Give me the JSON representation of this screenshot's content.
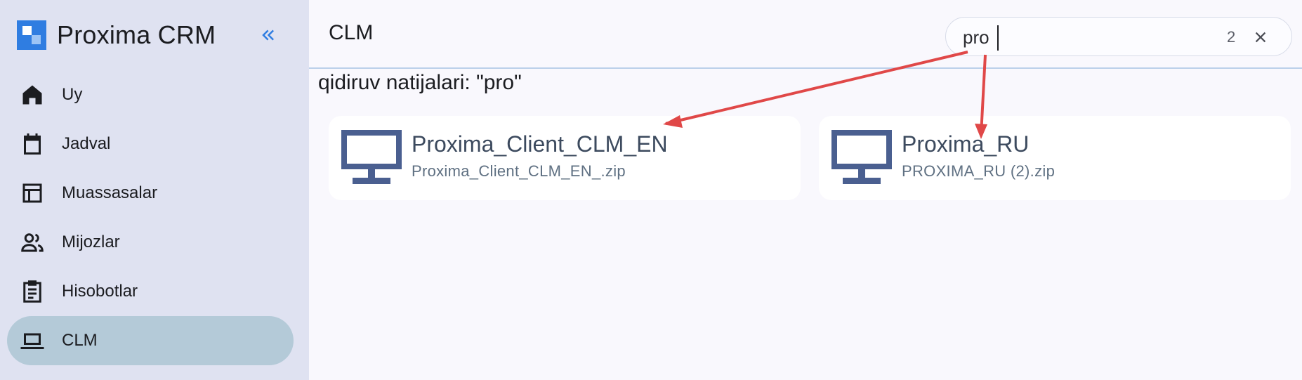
{
  "app": {
    "name": "Proxima CRM"
  },
  "sidebar": {
    "items": [
      {
        "label": "Uy",
        "icon": "home-icon",
        "active": false
      },
      {
        "label": "Jadval",
        "icon": "calendar-icon",
        "active": false
      },
      {
        "label": "Muassasalar",
        "icon": "table-icon",
        "active": false
      },
      {
        "label": "Mijozlar",
        "icon": "people-icon",
        "active": false
      },
      {
        "label": "Hisobotlar",
        "icon": "clipboard-icon",
        "active": false
      },
      {
        "label": "CLM",
        "icon": "laptop-icon",
        "active": true
      }
    ]
  },
  "header": {
    "title": "CLM"
  },
  "search": {
    "value": "pro",
    "count": "2"
  },
  "results": {
    "label": "qidiruv natijalari: \"pro\"",
    "items": [
      {
        "title": "Proxima_Client_CLM_EN",
        "file": "Proxima_Client_CLM_EN_.zip",
        "icon": "monitor-icon"
      },
      {
        "title": "Proxima_RU",
        "file": "PROXIMA_RU (2).zip",
        "icon": "monitor-icon"
      }
    ]
  },
  "colors": {
    "sidebar_bg": "#dfe2f1",
    "active_item": "#b4cad8",
    "accent": "#2f7de1",
    "icon_blue": "#4a5f90",
    "annotation_arrow": "#e04848"
  }
}
